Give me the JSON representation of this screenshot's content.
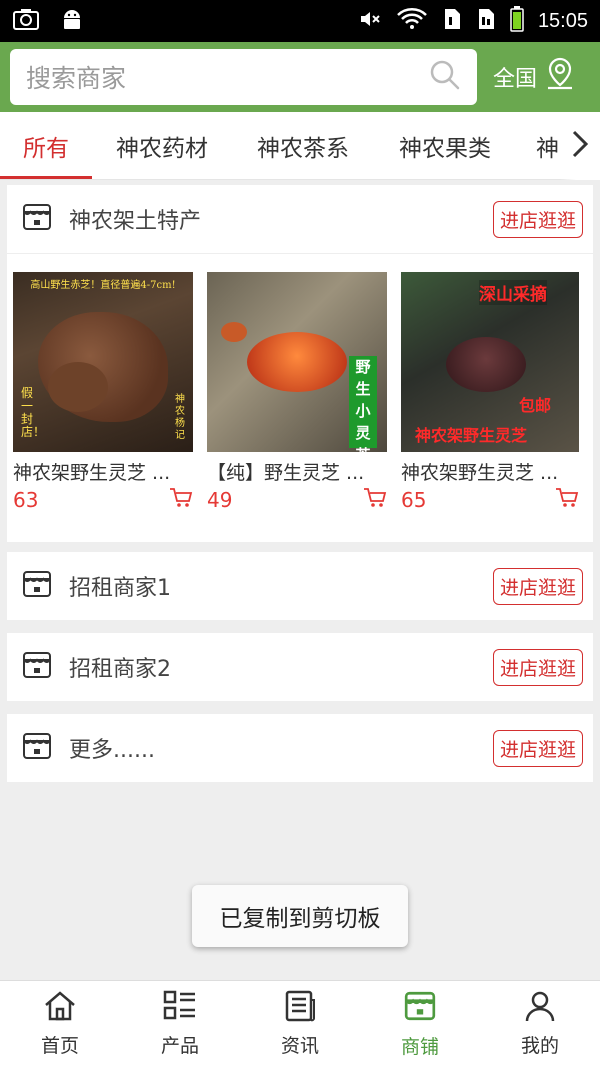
{
  "status_bar": {
    "time": "15:05"
  },
  "search": {
    "placeholder": "搜索商家",
    "region": "全国"
  },
  "tabs": [
    {
      "label": "所有",
      "active": true
    },
    {
      "label": "神农药材"
    },
    {
      "label": "神农茶系"
    },
    {
      "label": "神农果类"
    },
    {
      "label": "神"
    }
  ],
  "shops": [
    {
      "name": "神农架土特产",
      "button": "进店逛逛",
      "products": [
        {
          "name": "神农架野生灵芝 ...",
          "price": "63",
          "overlay": [
            "高山野生赤芝！直径普遍4-7cm!",
            "假一封店！",
            "神农杨记"
          ]
        },
        {
          "name": "【纯】野生灵芝 ...",
          "price": "49",
          "overlay": [
            "野生小灵芝"
          ]
        },
        {
          "name": "神农架野生灵芝 ...",
          "price": "65",
          "overlay": [
            "深山采摘",
            "包邮",
            "神农架野生灵芝"
          ]
        }
      ]
    },
    {
      "name": "招租商家1",
      "button": "进店逛逛"
    },
    {
      "name": "招租商家2",
      "button": "进店逛逛"
    },
    {
      "name": "更多......",
      "button": "进店逛逛"
    }
  ],
  "toast": "已复制到剪切板",
  "nav": [
    {
      "label": "首页",
      "icon": "home-icon"
    },
    {
      "label": "产品",
      "icon": "grid-list-icon"
    },
    {
      "label": "资讯",
      "icon": "news-icon"
    },
    {
      "label": "商铺",
      "icon": "store-icon",
      "active": true
    },
    {
      "label": "我的",
      "icon": "user-icon"
    }
  ],
  "colors": {
    "header_green": "#6aa84f",
    "accent_red": "#d32f2f",
    "price_red": "#e53935",
    "nav_active": "#4e9a3f"
  }
}
